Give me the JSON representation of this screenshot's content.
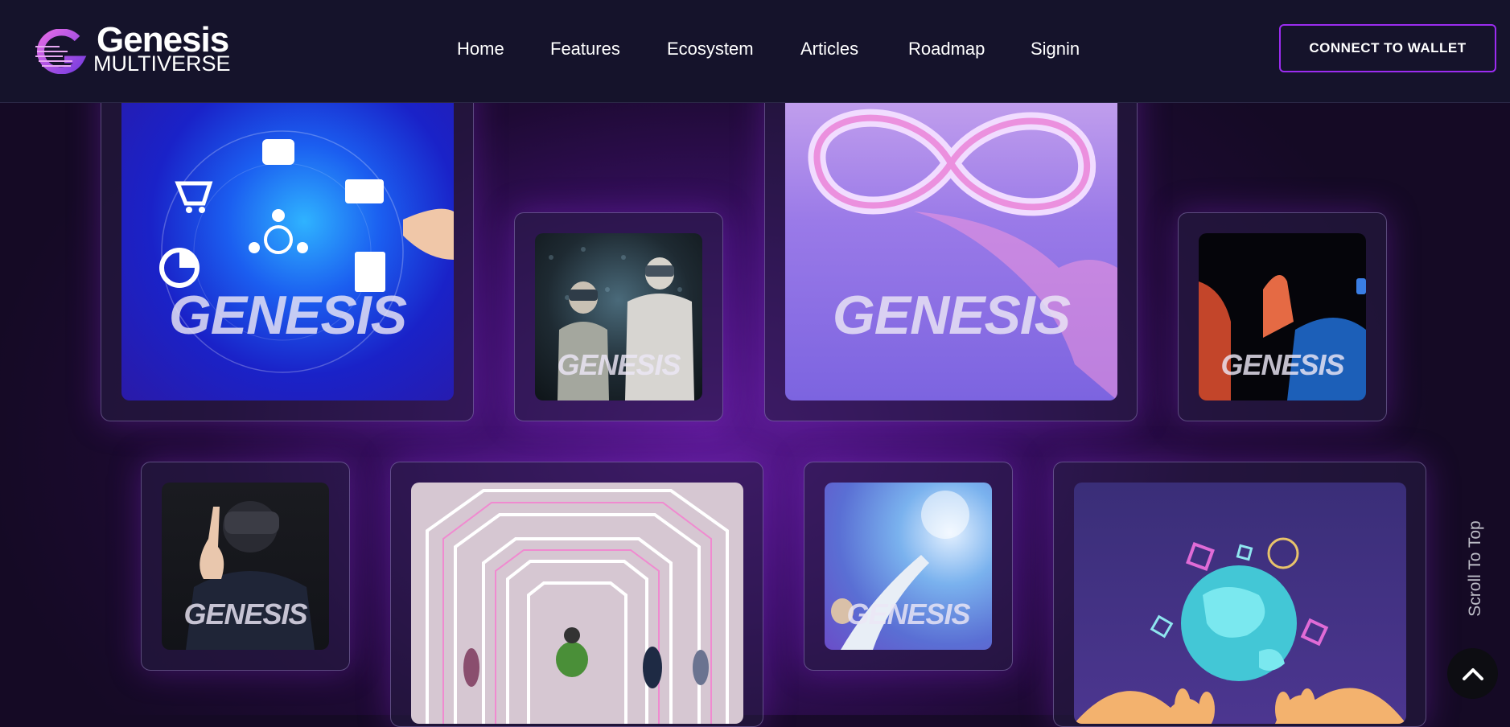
{
  "brand": {
    "name": "Genesis",
    "tagline": "MULTIVERSE"
  },
  "nav": {
    "items": [
      {
        "label": "Home"
      },
      {
        "label": "Features"
      },
      {
        "label": "Ecosystem"
      },
      {
        "label": "Articles"
      },
      {
        "label": "Roadmap"
      },
      {
        "label": "Signin"
      }
    ]
  },
  "header": {
    "wallet_button": "CONNECT TO WALLET"
  },
  "gallery": {
    "watermark": "GENESIS",
    "images": [
      {
        "subject": "digital-finance-globe"
      },
      {
        "subject": "vr-users-hologram"
      },
      {
        "subject": "infinity-symbol"
      },
      {
        "subject": "vr-users-neon"
      },
      {
        "subject": "vr-user-pointing"
      },
      {
        "subject": "neon-tunnel-avatars"
      },
      {
        "subject": "hand-touching-globe"
      },
      {
        "subject": "hands-holding-globe"
      }
    ]
  },
  "scroll": {
    "label": "Scroll To Top"
  },
  "colors": {
    "accent": "#9b2cf0",
    "header_bg": "#15132b",
    "page_bg": "#1e0a34"
  },
  "icons": [
    "logo-mark-icon",
    "chevron-up-icon"
  ]
}
